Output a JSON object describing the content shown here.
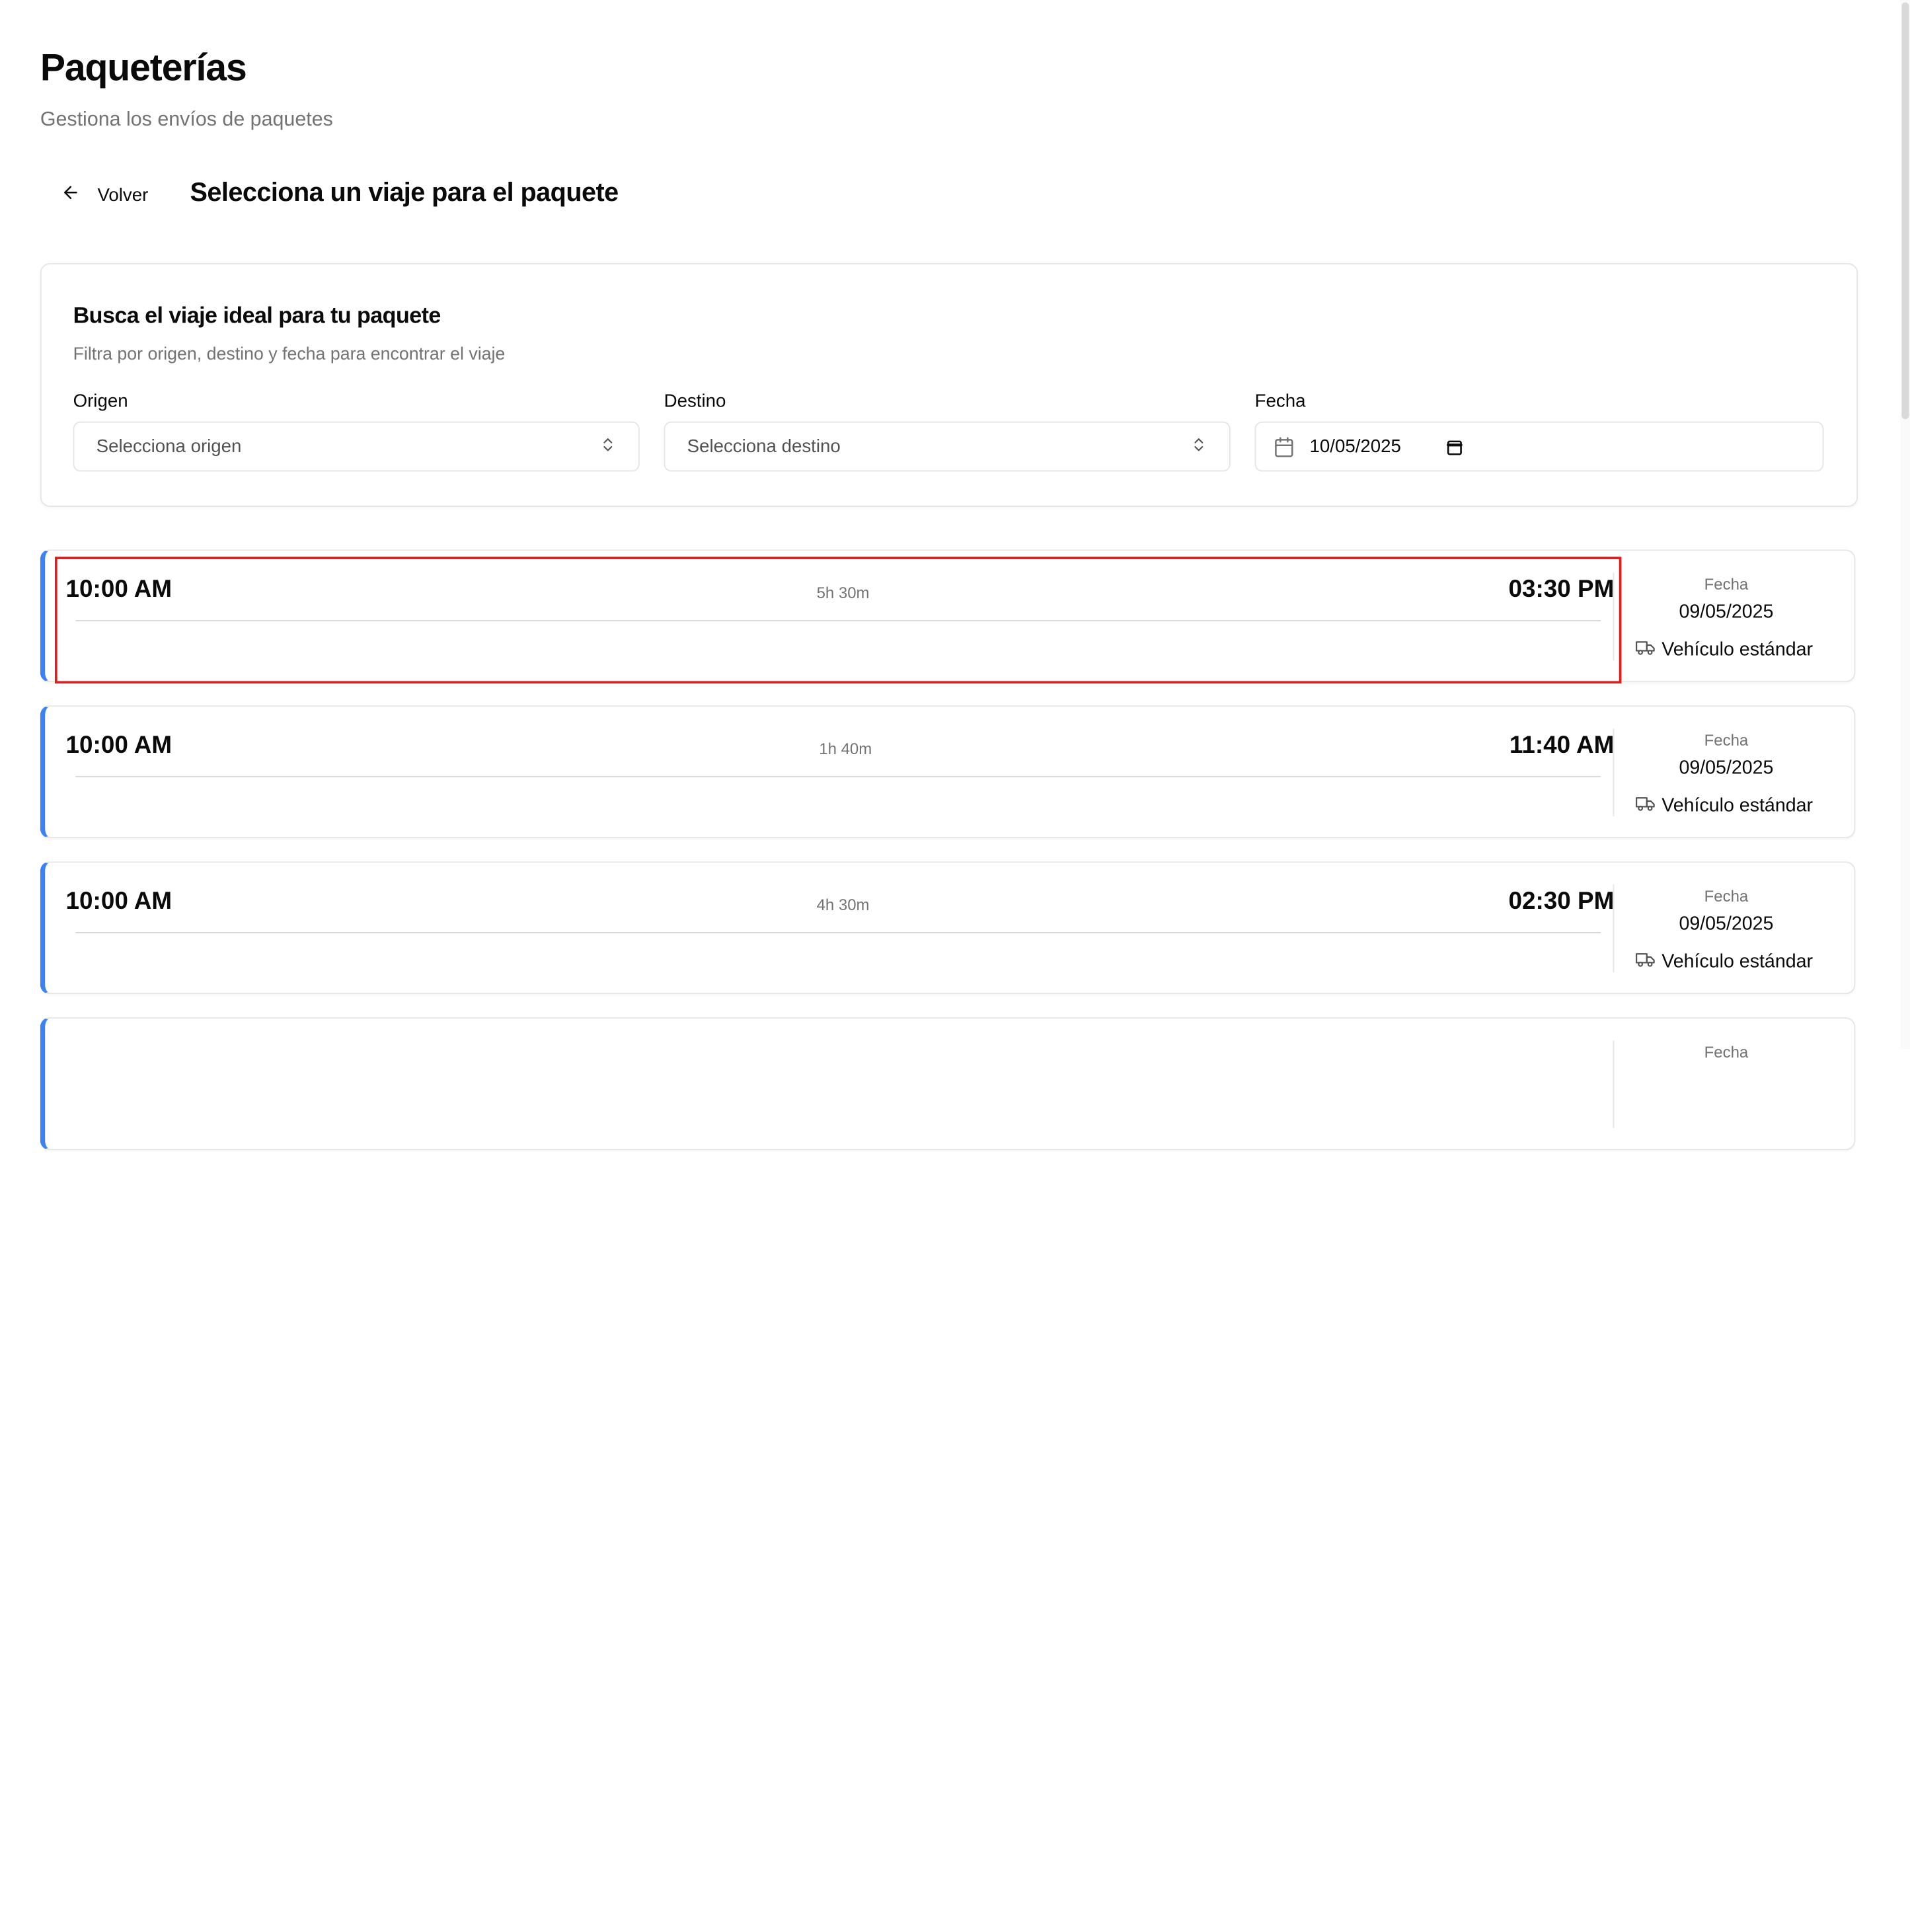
{
  "page": {
    "title": "Paqueterías",
    "subtitle": "Gestiona los envíos de paquetes"
  },
  "nav": {
    "back_label": "Volver",
    "section_title": "Selecciona un viaje para el paquete"
  },
  "search": {
    "title": "Busca el viaje ideal para tu paquete",
    "description": "Filtra por origen, destino y fecha para encontrar el viaje",
    "origin_label": "Origen",
    "origin_placeholder": "Selecciona origen",
    "destination_label": "Destino",
    "destination_placeholder": "Selecciona destino",
    "date_label": "Fecha",
    "date_value": "10/05/2025"
  },
  "trips": [
    {
      "departure": "10:00 AM",
      "duration": "5h 30m",
      "arrival": "03:30 PM",
      "date_label": "Fecha",
      "date": "09/05/2025",
      "vehicle": "Vehículo estándar"
    },
    {
      "departure": "10:00 AM",
      "duration": "1h 40m",
      "arrival": "11:40 AM",
      "date_label": "Fecha",
      "date": "09/05/2025",
      "vehicle": "Vehículo estándar"
    },
    {
      "departure": "10:00 AM",
      "duration": "4h 30m",
      "arrival": "02:30 PM",
      "date_label": "Fecha",
      "date": "09/05/2025",
      "vehicle": "Vehículo estándar"
    },
    {
      "date_label": "Fecha"
    }
  ],
  "colors": {
    "accent": "#3b82f6",
    "highlight": "#e11d1d",
    "muted_text": "#737373",
    "border": "#e5e5e5"
  },
  "icons": {
    "back": "arrow-left-icon",
    "select": "chevrons-up-down-icon",
    "date": "calendar-icon",
    "vehicle": "truck-icon"
  }
}
